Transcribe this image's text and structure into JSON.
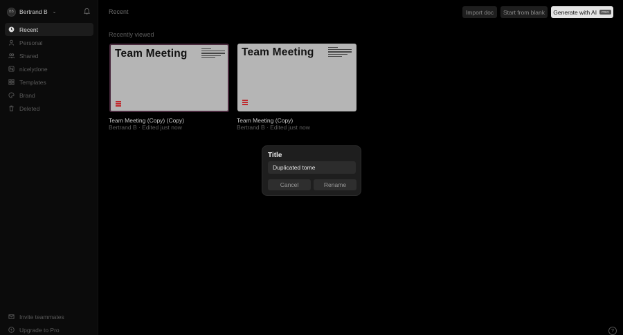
{
  "user": {
    "initials": "BB",
    "name": "Bertrand B",
    "caret": "⌄"
  },
  "sidebar": {
    "items": [
      {
        "label": "Recent",
        "icon": "clock-icon",
        "active": true
      },
      {
        "label": "Personal",
        "icon": "person-icon"
      },
      {
        "label": "Shared",
        "icon": "people-icon"
      },
      {
        "label": "nicelydone",
        "icon": "team-icon"
      },
      {
        "label": "Templates",
        "icon": "templates-icon"
      },
      {
        "label": "Brand",
        "icon": "palette-icon"
      },
      {
        "label": "Deleted",
        "icon": "trash-icon"
      }
    ],
    "bottom": [
      {
        "label": "Invite teammates",
        "icon": "mail-icon"
      },
      {
        "label": "Upgrade to Pro",
        "icon": "bolt-icon"
      }
    ]
  },
  "header": {
    "breadcrumb": "Recent",
    "import_label": "Import doc",
    "blank_label": "Start from blank",
    "ai_label": "Generate with AI",
    "ai_badge": "PRO"
  },
  "section": {
    "title": "Recently viewed"
  },
  "docs": [
    {
      "preview_title": "Team Meeting",
      "title": "Team Meeting (Copy) (Copy)",
      "meta": "Bertrand B · Edited just now",
      "selected": true
    },
    {
      "preview_title": "Team Meeting",
      "title": "Team Meeting (Copy)",
      "meta": "Bertrand B · Edited just now",
      "selected": false
    }
  ],
  "dialog": {
    "title": "Title",
    "value": "Duplicated tome",
    "cancel_label": "Cancel",
    "rename_label": "Rename"
  },
  "help": {
    "glyph": "?"
  },
  "colors": {
    "brand_logo": "#c0282d",
    "accent_button": "#e4e4e4",
    "background": "#000000"
  }
}
